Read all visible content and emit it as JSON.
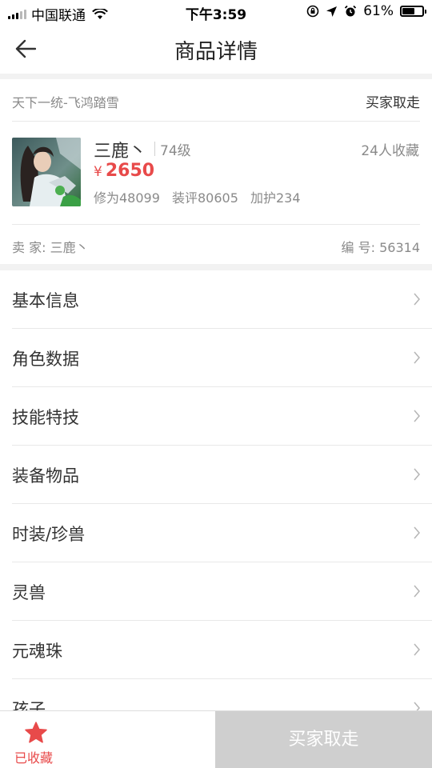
{
  "status_bar": {
    "carrier": "中国联通",
    "time": "下午3:59",
    "battery": "61%",
    "battery_level": 0.61
  },
  "nav": {
    "title": "商品详情"
  },
  "product": {
    "server": "天下一统-飞鸿踏雪",
    "status": "买家取走",
    "role_name": "三鹿丶",
    "level": "74级",
    "favorites": "24人收藏",
    "price_symbol": "¥",
    "price": "2650",
    "stats": [
      "修为48099",
      "装评80605",
      "加护234"
    ],
    "seller": "卖  家: 三鹿丶",
    "serial": "编  号: 56314"
  },
  "menu": [
    {
      "label": "基本信息"
    },
    {
      "label": "角色数据"
    },
    {
      "label": "技能特技"
    },
    {
      "label": "装备物品"
    },
    {
      "label": "时装/珍兽"
    },
    {
      "label": "灵兽"
    },
    {
      "label": "元魂珠"
    },
    {
      "label": "孩子"
    }
  ],
  "bottom": {
    "fav_label": "已收藏",
    "buy_label": "买家取走"
  },
  "colors": {
    "accent_red": "#e84a4a",
    "disabled_gray": "#cfcfcf"
  },
  "icons": [
    "back-arrow-icon",
    "wifi-icon",
    "star-icon",
    "chevron-right-icon",
    "location-icon",
    "alarm-icon",
    "lock-rotation-icon"
  ]
}
